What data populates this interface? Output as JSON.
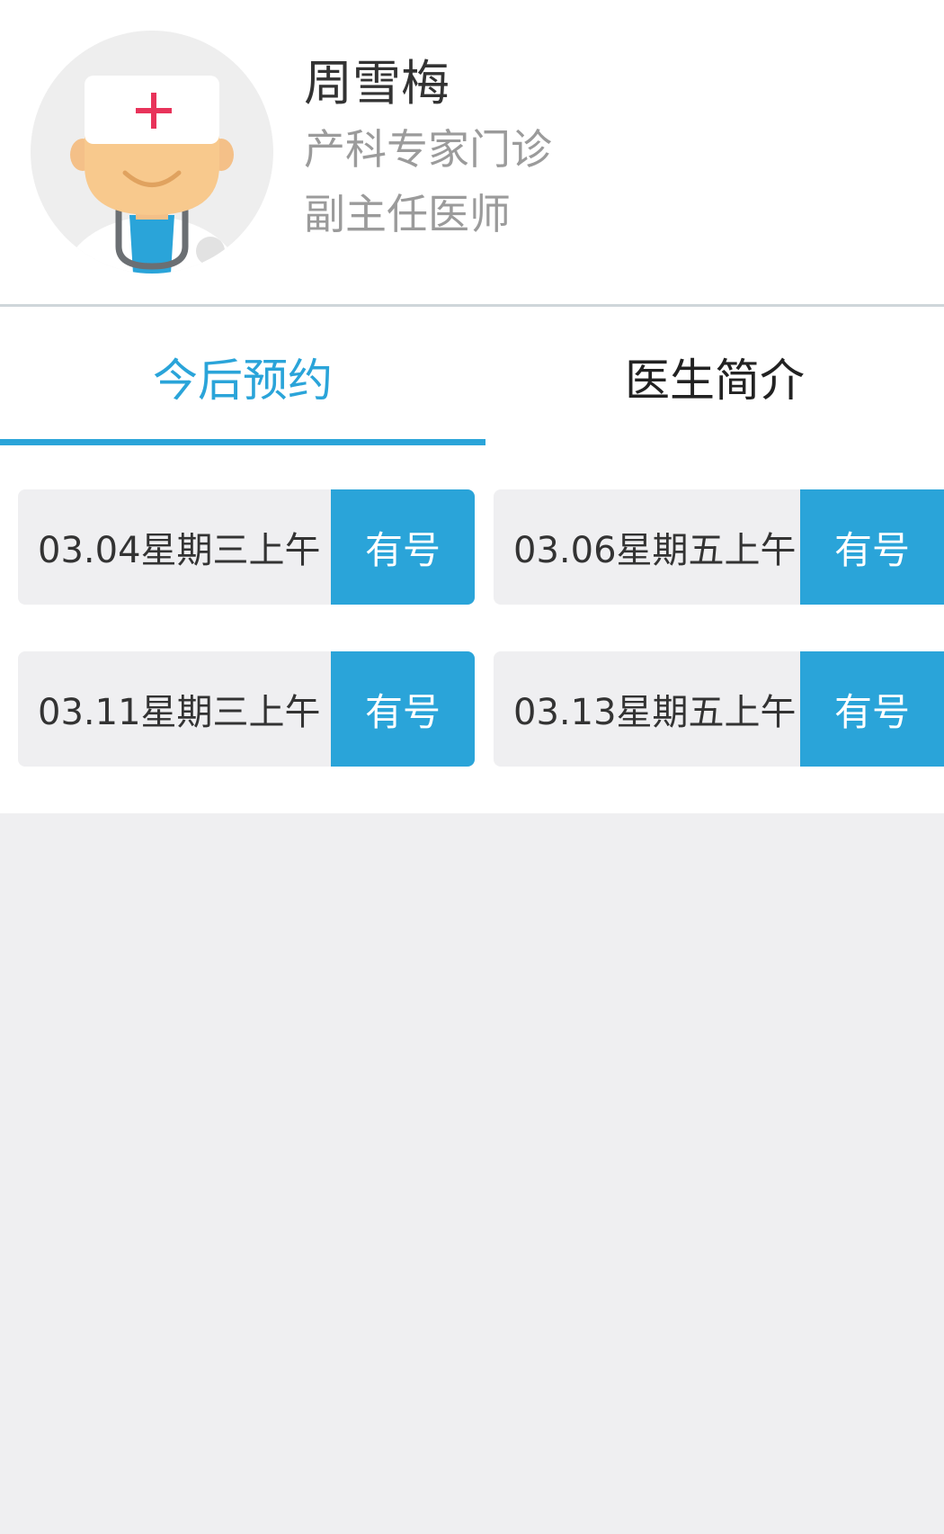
{
  "doctor": {
    "name": "周雪梅",
    "department": "产科专家门诊",
    "title": "副主任医师",
    "avatar_icon": "doctor-avatar-icon"
  },
  "tabs": [
    {
      "label": "今后预约",
      "active": true
    },
    {
      "label": "医生简介",
      "active": false
    }
  ],
  "colors": {
    "accent": "#2aa4d9",
    "background": "#efeff1",
    "cross": "#e8335a"
  },
  "slots": [
    {
      "date": "03.04星期三上午",
      "status": "有号"
    },
    {
      "date": "03.06星期五上午",
      "status": "有号"
    },
    {
      "date": "03.11星期三上午",
      "status": "有号"
    },
    {
      "date": "03.13星期五上午",
      "status": "有号"
    }
  ]
}
